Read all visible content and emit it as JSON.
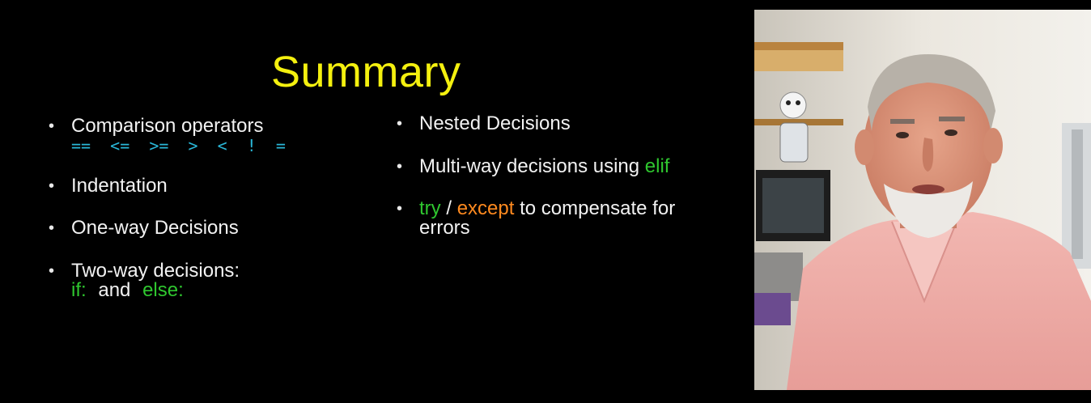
{
  "slide": {
    "title": "Summary",
    "left_items": [
      {
        "text": "Comparison operators",
        "sub": "==  <=  >=  >  <  !  ="
      },
      {
        "text": "Indentation"
      },
      {
        "text": "One-way Decisions"
      },
      {
        "text": "Two-way decisions:",
        "sub_parts": [
          "if:",
          "and",
          "else:"
        ]
      }
    ],
    "right_items": [
      {
        "text": "Nested Decisions"
      },
      {
        "text_parts": [
          "Multi-way decisions using",
          "elif"
        ]
      },
      {
        "text_parts": [
          "try",
          "/",
          "except",
          "to compensate for",
          "errors"
        ]
      }
    ],
    "bullet": "•"
  },
  "colors": {
    "background": "#000000",
    "title": "#f4f00f",
    "operators": "#2ab7d8",
    "keyword_green": "#2fc72f",
    "keyword_orange": "#ff8a1f"
  },
  "video": {
    "subject": "presenter-webcam-feed"
  }
}
